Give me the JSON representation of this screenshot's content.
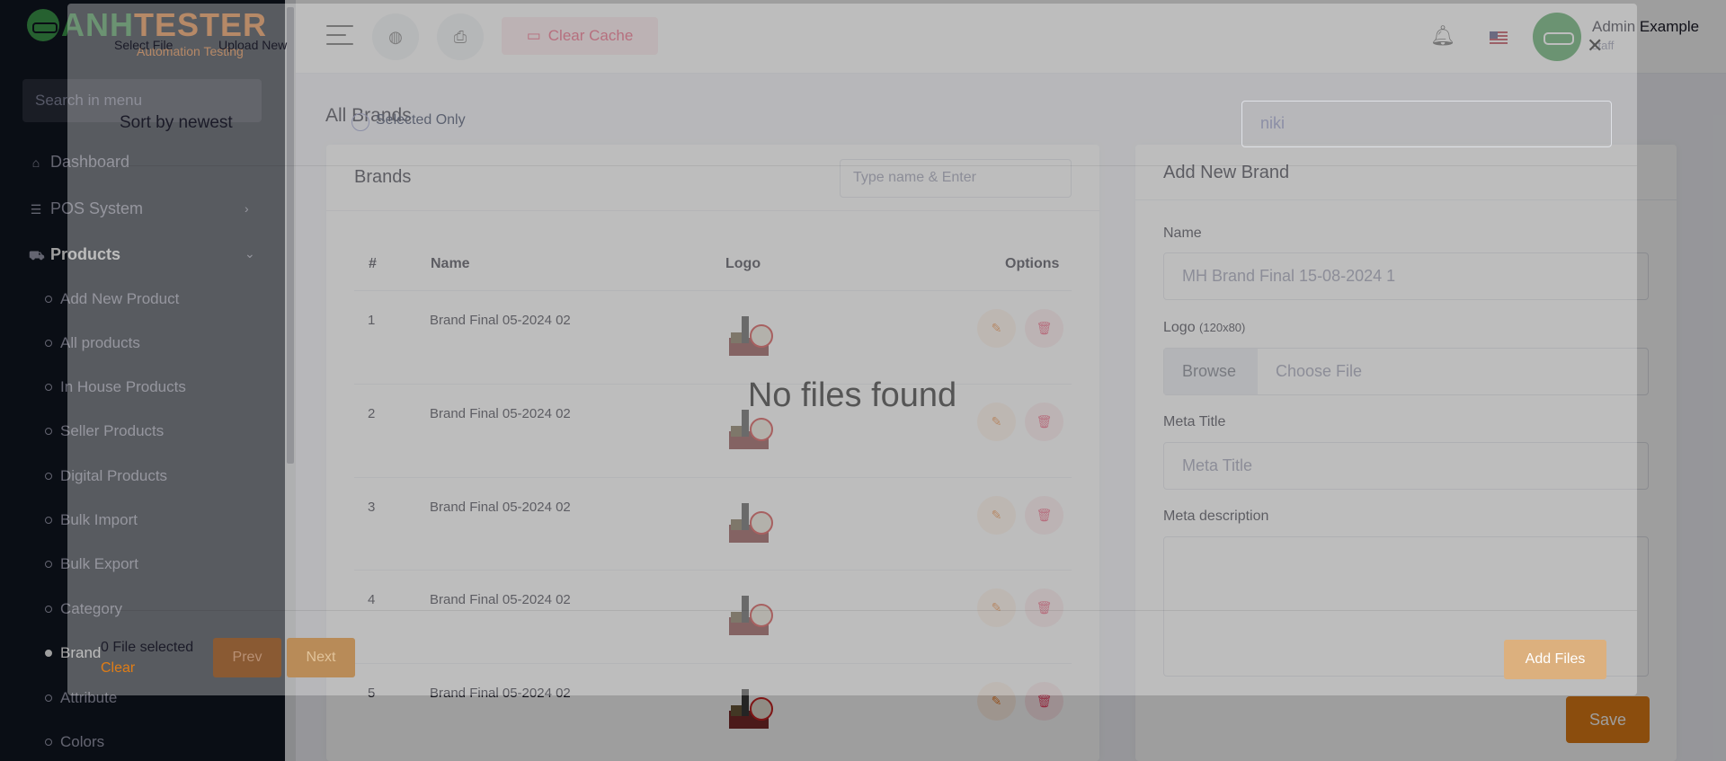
{
  "brand": {
    "name_a": "ANH",
    "name_b": "TESTER",
    "tagline": "Automation Testing"
  },
  "sidebar": {
    "search_placeholder": "Search in menu",
    "items": [
      {
        "label": "Dashboard",
        "icon": "home-icon"
      },
      {
        "label": "POS System",
        "icon": "list-icon"
      },
      {
        "label": "Products",
        "icon": "cart-icon"
      }
    ],
    "sub_items": [
      "Add New Product",
      "All products",
      "In House Products",
      "Seller Products",
      "Digital Products",
      "Bulk Import",
      "Bulk Export",
      "Category",
      "Brand",
      "Attribute",
      "Colors"
    ],
    "active_sub": "Brand"
  },
  "topbar": {
    "clear_cache": "Clear Cache",
    "user_name": "Admin Example",
    "user_role": "staff"
  },
  "page": {
    "title": "All Brands"
  },
  "brands": {
    "title": "Brands",
    "search_placeholder": "Type name & Enter",
    "columns": {
      "num": "#",
      "name": "Name",
      "logo": "Logo",
      "options": "Options"
    },
    "rows": [
      {
        "num": "1",
        "name": "Brand Final 05-2024 02"
      },
      {
        "num": "2",
        "name": "Brand Final 05-2024 02"
      },
      {
        "num": "3",
        "name": "Brand Final 05-2024 02"
      },
      {
        "num": "4",
        "name": "Brand Final 05-2024 02"
      },
      {
        "num": "5",
        "name": "Brand Final 05-2024 02"
      }
    ]
  },
  "add_brand": {
    "title": "Add New Brand",
    "name_label": "Name",
    "name_value": "MH Brand Final 15-08-2024 1",
    "logo_label": "Logo",
    "logo_hint": "(120x80)",
    "browse": "Browse",
    "choose_file": "Choose File",
    "meta_title_label": "Meta Title",
    "meta_title_placeholder": "Meta Title",
    "meta_desc_label": "Meta description",
    "save": "Save"
  },
  "modal": {
    "tab_select": "Select File",
    "tab_upload": "Upload New",
    "sort": "Sort by newest",
    "selected_only": "Selected Only",
    "search_value": "niki",
    "empty": "No files found",
    "file_selected": "0 File selected",
    "clear": "Clear",
    "prev": "Prev",
    "next": "Next",
    "add_files": "Add Files"
  },
  "colors": {
    "accent": "#e17d15",
    "sidebar_bg": "#111723",
    "danger": "#ef486a"
  }
}
